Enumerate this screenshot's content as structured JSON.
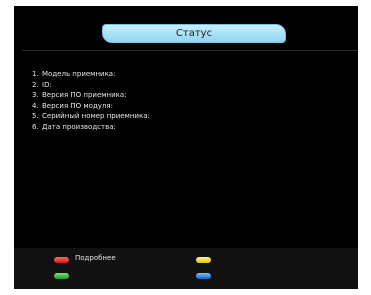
{
  "header": {
    "title": "Статус"
  },
  "info": {
    "items": [
      {
        "num": "1.",
        "label": "Модель приемника:"
      },
      {
        "num": "2.",
        "label": "ID:"
      },
      {
        "num": "3.",
        "label": "Версия ПО приемника:"
      },
      {
        "num": "4.",
        "label": "Версия ПО модуля:"
      },
      {
        "num": "5.",
        "label": "Серийный номер приемника:"
      },
      {
        "num": "6.",
        "label": "Дата производства:"
      }
    ]
  },
  "footer": {
    "red_label": "Подробнее"
  },
  "colors": {
    "background": "#000000",
    "title_tab": "#8fd6f4",
    "red_key": "#d91212",
    "green_key": "#159a2a",
    "yellow_key": "#e6c20a",
    "blue_key": "#0f5cc9"
  }
}
